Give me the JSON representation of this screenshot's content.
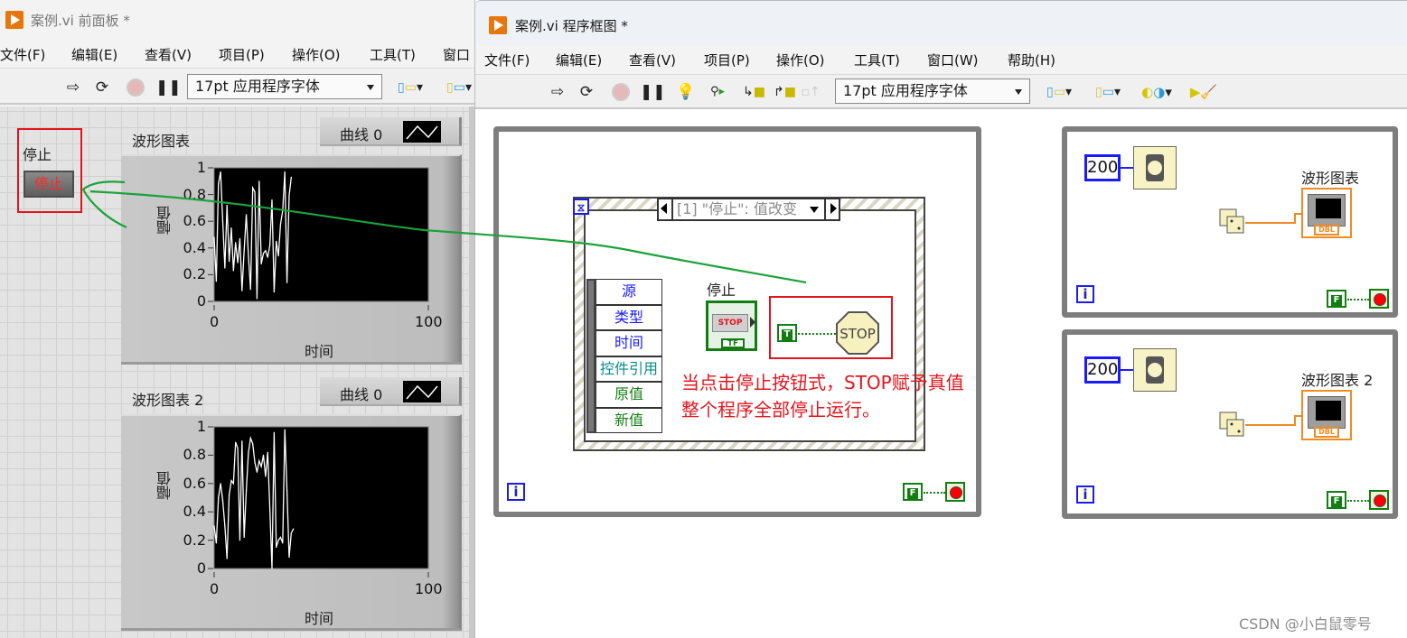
{
  "front_panel": {
    "title": "案例.vi 前面板 *",
    "menu": [
      "文件(F)",
      "编辑(E)",
      "查看(V)",
      "项目(P)",
      "操作(O)",
      "工具(T)",
      "窗口"
    ],
    "toolbar": {
      "icons": [
        "run-arrow-icon",
        "run-continuously-icon",
        "abort-icon",
        "pause-icon"
      ],
      "font_select": "17pt 应用程序字体"
    },
    "stop_control": {
      "label": "停止",
      "button_text": "停止"
    },
    "charts": [
      {
        "label": "波形图表",
        "legend": "曲线 0",
        "xlabel": "时间",
        "ylabel": "幅值",
        "yticks": [
          "1",
          "0.8",
          "0.6",
          "0.4",
          "0.2",
          "0"
        ],
        "xticks": [
          "0",
          "100"
        ]
      },
      {
        "label": "波形图表 2",
        "legend": "曲线 0",
        "xlabel": "时间",
        "ylabel": "幅值",
        "yticks": [
          "1",
          "0.8",
          "0.6",
          "0.4",
          "0.2",
          "0"
        ],
        "xticks": [
          "0",
          "100"
        ]
      }
    ]
  },
  "chart_data": [
    {
      "type": "line",
      "title": "波形图表",
      "xlabel": "时间",
      "ylabel": "幅值",
      "xlim": [
        0,
        100
      ],
      "ylim": [
        0,
        1
      ],
      "legend": [
        "曲线 0"
      ],
      "series": [
        {
          "name": "曲线 0",
          "values": [
            0.48,
            0.15,
            0.88,
            0.97,
            0.6,
            0.25,
            0.72,
            0.3,
            0.55,
            0.23,
            0.44,
            0.29,
            0.47,
            0.08,
            0.38,
            0.65,
            0.34,
            0.09,
            0.85,
            0.82,
            0.02,
            0.9,
            0.28,
            0.36,
            0.38,
            0.33,
            0.42,
            0.76,
            0.07,
            0.45,
            0.34,
            0.58,
            0.68,
            0.97,
            0.14,
            0.79,
            0.93
          ]
        }
      ]
    },
    {
      "type": "line",
      "title": "波形图表 2",
      "xlabel": "时间",
      "ylabel": "幅值",
      "xlim": [
        0,
        100
      ],
      "ylim": [
        0,
        1
      ],
      "legend": [
        "曲线 0"
      ],
      "series": [
        {
          "name": "曲线 0",
          "values": [
            0.3,
            0.18,
            0.5,
            0.6,
            0.48,
            0.3,
            0.07,
            0.52,
            0.62,
            0.6,
            0.89,
            0.85,
            0.2,
            0.9,
            0.22,
            0.55,
            0.82,
            0.92,
            0.88,
            0.75,
            0.68,
            0.76,
            0.72,
            0.8,
            0.65,
            0.82,
            0.42,
            0.0,
            0.96,
            0.15,
            0.2,
            0.22,
            0.18,
            0.98,
            0.55,
            0.08,
            0.25,
            0.28
          ]
        }
      ]
    }
  ],
  "block_diagram": {
    "title": "案例.vi 程序框图 *",
    "menu": [
      "文件(F)",
      "编辑(E)",
      "查看(V)",
      "项目(P)",
      "操作(O)",
      "工具(T)",
      "窗口(W)",
      "帮助(H)"
    ],
    "toolbar": {
      "icons": [
        "run-arrow-icon",
        "run-continuously-icon",
        "abort-icon",
        "pause-icon",
        "highlight-execution-icon",
        "retain-wire-values-icon",
        "step-into-icon",
        "step-over-icon",
        "step-out-icon"
      ],
      "font_select": "17pt 应用程序字体",
      "right_icons": [
        "align-objects-icon",
        "distribute-objects-icon",
        "reorder-icon",
        "clean-up-diagram-icon"
      ]
    },
    "event_structure": {
      "selector": "[1] \"停止\": 值改变",
      "event_data": [
        "源",
        "类型",
        "时间",
        "控件引用",
        "原值",
        "新值"
      ],
      "event_data_colors": [
        "#1a1aff",
        "#1a1aff",
        "#1a1aff",
        "#0a8a8a",
        "#127e12",
        "#127e12"
      ],
      "stop_terminal_label": "停止",
      "stop_terminal_text": "STOP",
      "stop_terminal_type": "TF",
      "true_constant": "T",
      "stop_function": "STOP"
    },
    "annotation": [
      "当点击停止按钮式，STOP赋予真值",
      "整个程序全部停止运行。"
    ],
    "loops": [
      {
        "iteration_terminal": "i",
        "stop_constant": "F"
      },
      {
        "wait_ms": "200",
        "chart_label": "波形图表",
        "chart_type": "DBL",
        "iteration_terminal": "i",
        "stop_constant": "F"
      },
      {
        "wait_ms": "200",
        "chart_label": "波形图表 2",
        "chart_type": "DBL",
        "iteration_terminal": "i",
        "stop_constant": "F"
      }
    ]
  },
  "watermark": "CSDN @小白鼠零号",
  "colors": {
    "annotation_red": "#e4141c",
    "wire_green": "#1aa33a",
    "labview_orange": "#e8760c",
    "double_wire": "#f08a24"
  }
}
